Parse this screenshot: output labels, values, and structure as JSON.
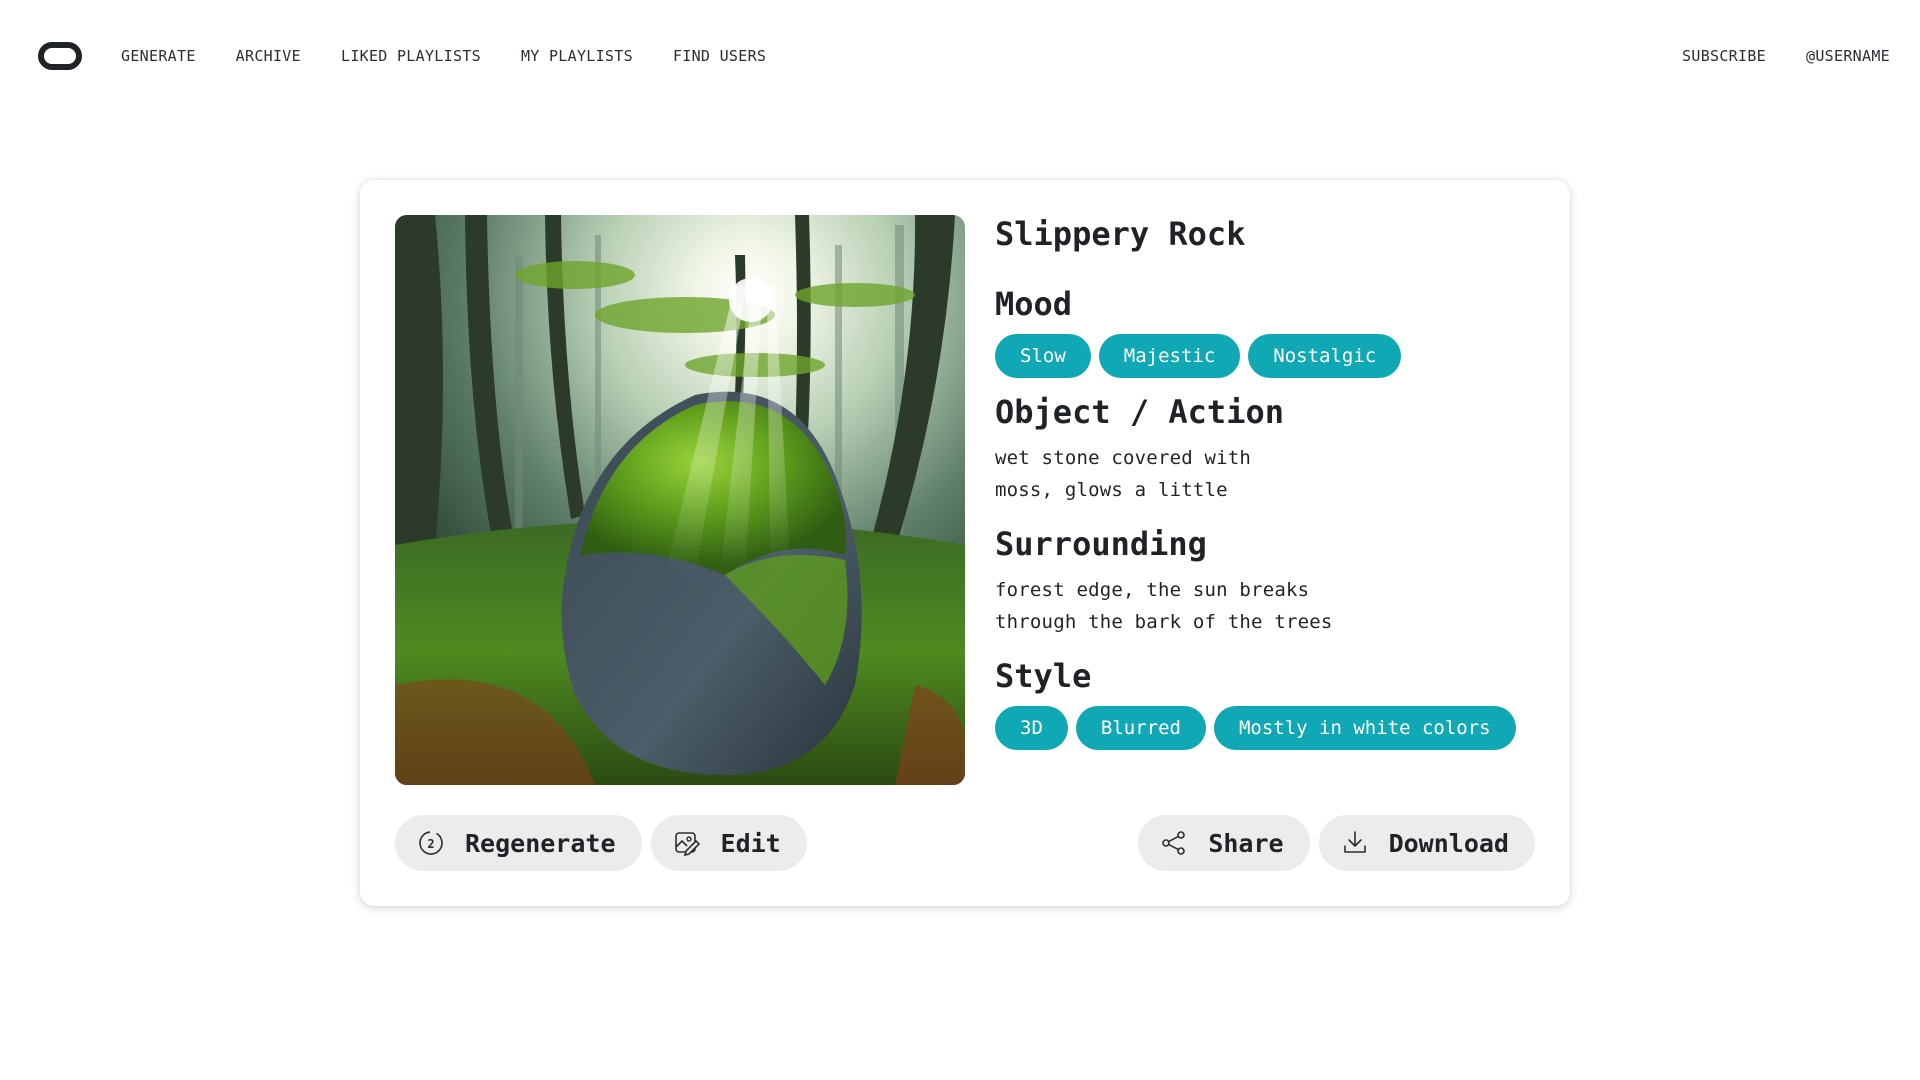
{
  "nav": {
    "logo_icon": "chain-link-logo",
    "links": [
      "GENERATE",
      "ARCHIVE",
      "LIKED PLAYLISTS",
      "MY PLAYLISTS",
      "FIND USERS"
    ],
    "subscribe": "SUBSCRIBE",
    "username": "@USERNAME"
  },
  "card": {
    "image_alt_subject": "moss-covered rock in sunlit forest",
    "title": "Slippery Rock",
    "mood": {
      "heading": "Mood",
      "tags": [
        "Slow",
        "Majestic",
        "Nostalgic"
      ]
    },
    "object_action": {
      "heading": "Object / Action",
      "lines": [
        "wet stone covered with",
        "moss, glows a little"
      ]
    },
    "surrounding": {
      "heading": "Surrounding",
      "lines": [
        "forest edge, the sun breaks",
        "through the bark of the trees"
      ]
    },
    "style": {
      "heading": "Style",
      "tags": [
        "3D",
        "Blurred",
        "Mostly in white colors"
      ]
    },
    "actions": {
      "regenerate": "Regenerate",
      "regenerate_badge": "2",
      "edit": "Edit",
      "share": "Share",
      "download": "Download"
    }
  },
  "colors": {
    "tag_bg": "#0fa8b4",
    "button_bg": "#ececec",
    "text": "#1f2328"
  }
}
